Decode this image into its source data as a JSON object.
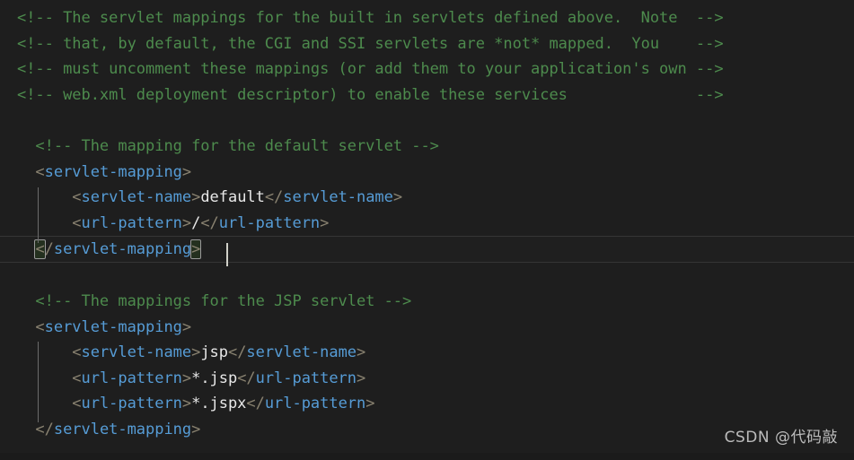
{
  "editor": {
    "language": "xml",
    "theme": "dark-plus",
    "colors": {
      "background": "#1e1e1e",
      "comment": "#4d8b4d",
      "tag": "#569cd6",
      "bracket": "#8a8371",
      "text": "#e8e8e8",
      "active_line_border": "#353535",
      "indent_guide": "#6b6b6b",
      "cursor": "#d0d0c8"
    },
    "cursor_line_text": "</servlet-mapping>",
    "lines": [
      {
        "id": "line-1",
        "active": false,
        "tokens": [
          {
            "cls": "t-comment",
            "text": "<!-- The servlet mappings for the built in servlets defined above.  Note  -->"
          }
        ]
      },
      {
        "id": "line-2",
        "active": false,
        "tokens": [
          {
            "cls": "t-comment",
            "text": "<!-- that, by default, the CGI and SSI servlets are *not* mapped.  You    -->"
          }
        ]
      },
      {
        "id": "line-3",
        "active": false,
        "tokens": [
          {
            "cls": "t-comment",
            "text": "<!-- must uncomment these mappings (or add them to your application's own -->"
          }
        ]
      },
      {
        "id": "line-4",
        "active": false,
        "tokens": [
          {
            "cls": "t-comment",
            "text": "<!-- web.xml deployment descriptor) to enable these services              -->"
          }
        ]
      },
      {
        "id": "line-5",
        "active": false,
        "tokens": [
          {
            "cls": "t-blank",
            "text": " "
          }
        ]
      },
      {
        "id": "line-6",
        "active": false,
        "tokens": [
          {
            "cls": "t-comment",
            "text": "  <!-- The mapping for the default servlet -->"
          }
        ]
      },
      {
        "id": "line-7",
        "active": false,
        "tokens": [
          {
            "cls": "t-bracket",
            "text": "  <"
          },
          {
            "cls": "t-tag",
            "text": "servlet-mapping"
          },
          {
            "cls": "t-bracket",
            "text": ">"
          }
        ]
      },
      {
        "id": "line-8",
        "active": false,
        "tokens": [
          {
            "cls": "t-bracket",
            "text": "      <"
          },
          {
            "cls": "t-tag",
            "text": "servlet-name"
          },
          {
            "cls": "t-bracket",
            "text": ">"
          },
          {
            "cls": "t-text",
            "text": "default"
          },
          {
            "cls": "t-bracket",
            "text": "</"
          },
          {
            "cls": "t-tag",
            "text": "servlet-name"
          },
          {
            "cls": "t-bracket",
            "text": ">"
          }
        ]
      },
      {
        "id": "line-9",
        "active": false,
        "tokens": [
          {
            "cls": "t-bracket",
            "text": "      <"
          },
          {
            "cls": "t-tag",
            "text": "url-pattern"
          },
          {
            "cls": "t-bracket",
            "text": ">"
          },
          {
            "cls": "t-text",
            "text": "/"
          },
          {
            "cls": "t-bracket",
            "text": "</"
          },
          {
            "cls": "t-tag",
            "text": "url-pattern"
          },
          {
            "cls": "t-bracket",
            "text": ">"
          }
        ]
      },
      {
        "id": "line-10",
        "active": true,
        "tokens": [
          {
            "cls": "t-blank",
            "text": "  "
          },
          {
            "cls": "t-bracket bracket-match",
            "text": "<"
          },
          {
            "cls": "t-bracket",
            "text": "/"
          },
          {
            "cls": "t-tag",
            "text": "servlet-mapping"
          },
          {
            "cls": "t-bracket bracket-match",
            "text": ">"
          }
        ]
      },
      {
        "id": "line-11",
        "active": false,
        "tokens": [
          {
            "cls": "t-blank",
            "text": " "
          }
        ]
      },
      {
        "id": "line-12",
        "active": false,
        "tokens": [
          {
            "cls": "t-comment",
            "text": "  <!-- The mappings for the JSP servlet -->"
          }
        ]
      },
      {
        "id": "line-13",
        "active": false,
        "tokens": [
          {
            "cls": "t-bracket",
            "text": "  <"
          },
          {
            "cls": "t-tag",
            "text": "servlet-mapping"
          },
          {
            "cls": "t-bracket",
            "text": ">"
          }
        ]
      },
      {
        "id": "line-14",
        "active": false,
        "tokens": [
          {
            "cls": "t-bracket",
            "text": "      <"
          },
          {
            "cls": "t-tag",
            "text": "servlet-name"
          },
          {
            "cls": "t-bracket",
            "text": ">"
          },
          {
            "cls": "t-text",
            "text": "jsp"
          },
          {
            "cls": "t-bracket",
            "text": "</"
          },
          {
            "cls": "t-tag",
            "text": "servlet-name"
          },
          {
            "cls": "t-bracket",
            "text": ">"
          }
        ]
      },
      {
        "id": "line-15",
        "active": false,
        "tokens": [
          {
            "cls": "t-bracket",
            "text": "      <"
          },
          {
            "cls": "t-tag",
            "text": "url-pattern"
          },
          {
            "cls": "t-bracket",
            "text": ">"
          },
          {
            "cls": "t-text",
            "text": "*.jsp"
          },
          {
            "cls": "t-bracket",
            "text": "</"
          },
          {
            "cls": "t-tag",
            "text": "url-pattern"
          },
          {
            "cls": "t-bracket",
            "text": ">"
          }
        ]
      },
      {
        "id": "line-16",
        "active": false,
        "tokens": [
          {
            "cls": "t-bracket",
            "text": "      <"
          },
          {
            "cls": "t-tag",
            "text": "url-pattern"
          },
          {
            "cls": "t-bracket",
            "text": ">"
          },
          {
            "cls": "t-text",
            "text": "*.jspx"
          },
          {
            "cls": "t-bracket",
            "text": "</"
          },
          {
            "cls": "t-tag",
            "text": "url-pattern"
          },
          {
            "cls": "t-bracket",
            "text": ">"
          }
        ]
      },
      {
        "id": "line-17",
        "active": false,
        "tokens": [
          {
            "cls": "t-bracket",
            "text": "  </"
          },
          {
            "cls": "t-tag",
            "text": "servlet-mapping"
          },
          {
            "cls": "t-bracket",
            "text": ">"
          }
        ]
      }
    ]
  },
  "watermark": {
    "text": "CSDN @代码敲"
  }
}
